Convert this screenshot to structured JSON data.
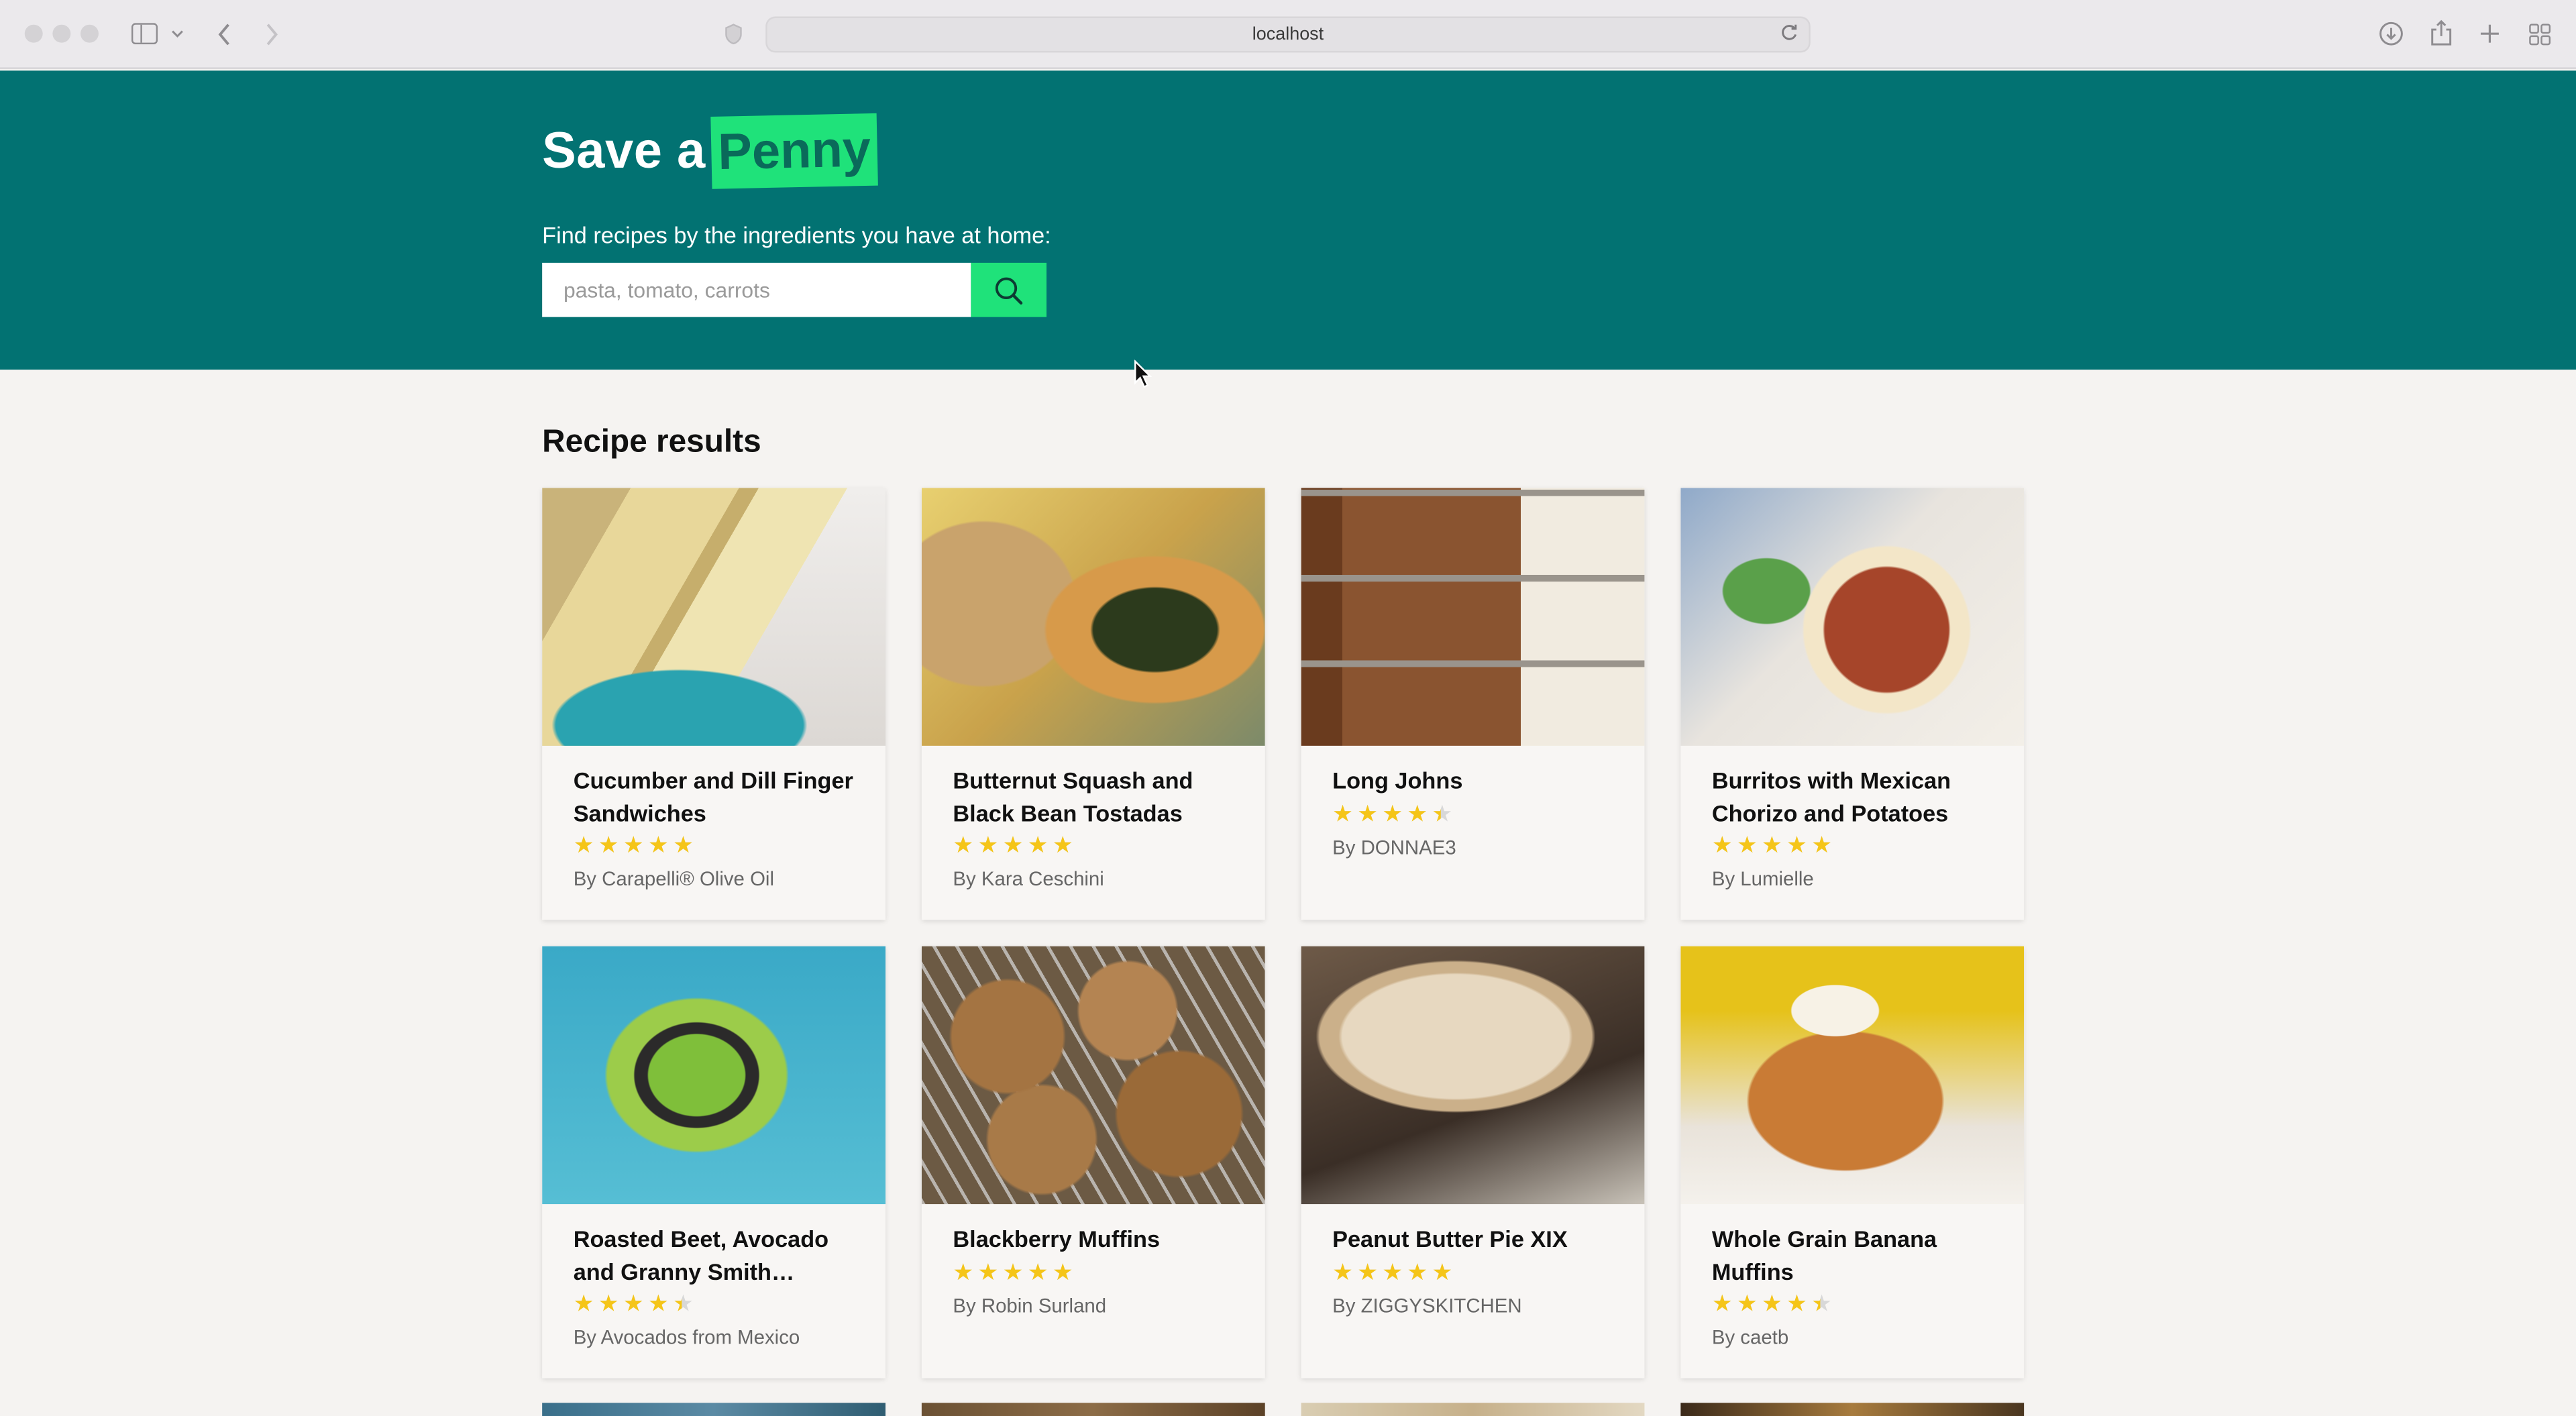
{
  "browser": {
    "url": "localhost"
  },
  "brand": {
    "prefix": "Save a",
    "highlight": "Penny",
    "highlight_color": "#1fe27a",
    "hero_color": "#027272"
  },
  "search": {
    "prompt": "Find recipes by the ingredients you have at home:",
    "placeholder": "pasta, tomato, carrots",
    "value": ""
  },
  "results": {
    "heading": "Recipe results",
    "recipes": [
      {
        "title": "Cucumber and Dill Finger Sandwiches",
        "author": "By Carapelli® Olive Oil",
        "rating": 4.5,
        "image": "cucumber-sandwich-photo"
      },
      {
        "title": "Butternut Squash and Black Bean Tostadas",
        "author": "By Kara Ceschini",
        "rating": 5,
        "image": "tostada-photo"
      },
      {
        "title": "Long Johns",
        "author": "By DONNAE3",
        "rating": 4,
        "image": "long-johns-photo"
      },
      {
        "title": "Burritos with Mexican Chorizo and Potatoes",
        "author": "By Lumielle",
        "rating": 4.5,
        "image": "burrito-photo"
      },
      {
        "title": "Roasted Beet, Avocado and Granny Smith Apple...",
        "author": "By Avocados from Mexico",
        "rating": 4,
        "image": "beet-avocado-stack-photo"
      },
      {
        "title": "Blackberry Muffins",
        "author": "By Robin Surland",
        "rating": 4.5,
        "image": "blackberry-muffins-photo"
      },
      {
        "title": "Peanut Butter Pie XIX",
        "author": "By ZIGGYSKITCHEN",
        "rating": 5,
        "image": "peanut-butter-pie-photo"
      },
      {
        "title": "Whole Grain Banana Muffins",
        "author": "By caetb",
        "rating": 4,
        "image": "banana-muffin-photo"
      }
    ]
  }
}
